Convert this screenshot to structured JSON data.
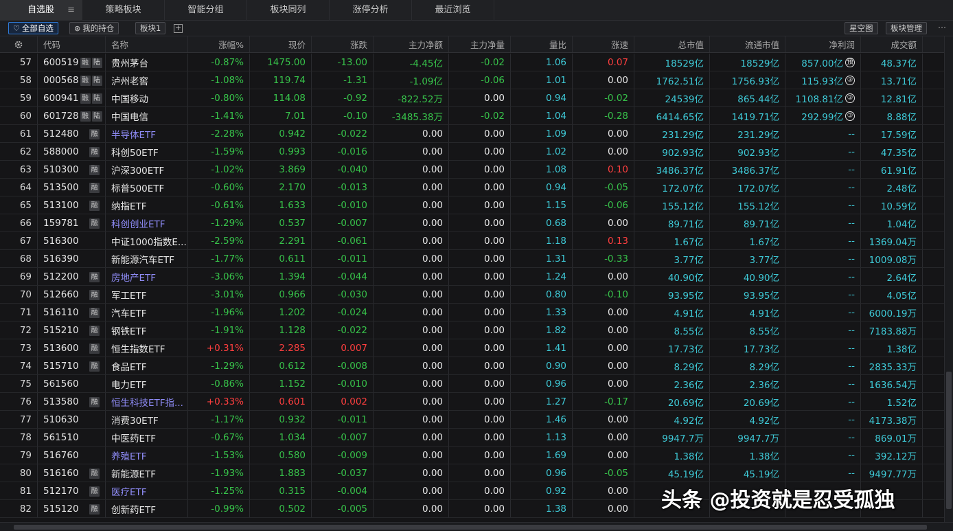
{
  "tabs": [
    {
      "label": "自选股",
      "active": true
    },
    {
      "label": "策略板块",
      "active": false
    },
    {
      "label": "智能分组",
      "active": false
    },
    {
      "label": "板块同列",
      "active": false
    },
    {
      "label": "涨停分析",
      "active": false
    },
    {
      "label": "最近浏览",
      "active": false
    }
  ],
  "toolbar": {
    "all_watchlist": "全部自选",
    "my_holdings": "我的持仓",
    "block1": "板块1",
    "add": "+",
    "star_chart": "星空图",
    "block_manage": "板块管理",
    "more": "⋯"
  },
  "columns": {
    "settings_icon": "gear-icon",
    "code": "代码",
    "name": "名称",
    "change_pct": "涨幅%",
    "price": "现价",
    "change": "涨跌",
    "main_net_amount": "主力净额",
    "main_net_ratio": "主力净量",
    "volume_ratio": "量比",
    "speed": "涨速",
    "total_mv": "总市值",
    "float_mv": "流通市值",
    "net_profit": "净利润",
    "turnover": "成交额"
  },
  "rows": [
    {
      "idx": "57",
      "code": "600519",
      "tags": [
        "融",
        "陆"
      ],
      "name": "贵州茅台",
      "link": false,
      "pct": "-0.87%",
      "price": "1475.00",
      "chg": "-13.00",
      "main_amt": "-4.45亿",
      "main_net": "-0.02",
      "vr": "1.06",
      "speed": "0.07",
      "total": "18529亿",
      "float": "18529亿",
      "profit": "857.00亿",
      "profit_badge": "预",
      "turnover": "48.37亿"
    },
    {
      "idx": "58",
      "code": "000568",
      "tags": [
        "融",
        "陆"
      ],
      "name": "泸州老窖",
      "link": false,
      "pct": "-1.08%",
      "price": "119.74",
      "chg": "-1.31",
      "main_amt": "-1.09亿",
      "main_net": "-0.06",
      "vr": "1.01",
      "speed": "0.00",
      "total": "1762.51亿",
      "float": "1756.93亿",
      "profit": "115.93亿",
      "profit_badge": "③",
      "turnover": "13.71亿"
    },
    {
      "idx": "59",
      "code": "600941",
      "tags": [
        "融",
        "陆"
      ],
      "name": "中国移动",
      "link": false,
      "pct": "-0.80%",
      "price": "114.08",
      "chg": "-0.92",
      "main_amt": "-822.52万",
      "main_net": "0.00",
      "vr": "0.94",
      "speed": "-0.02",
      "total": "24539亿",
      "float": "865.44亿",
      "profit": "1108.81亿",
      "profit_badge": "③",
      "turnover": "12.81亿"
    },
    {
      "idx": "60",
      "code": "601728",
      "tags": [
        "融",
        "陆"
      ],
      "name": "中国电信",
      "link": false,
      "pct": "-1.41%",
      "price": "7.01",
      "chg": "-0.10",
      "main_amt": "-3485.38万",
      "main_net": "-0.02",
      "vr": "1.04",
      "speed": "-0.28",
      "total": "6414.65亿",
      "float": "1419.71亿",
      "profit": "292.99亿",
      "profit_badge": "③",
      "turnover": "8.88亿"
    },
    {
      "idx": "61",
      "code": "512480",
      "tags": [
        "融"
      ],
      "name": "半导体ETF",
      "link": true,
      "pct": "-2.28%",
      "price": "0.942",
      "chg": "-0.022",
      "main_amt": "0.00",
      "main_net": "0.00",
      "vr": "1.09",
      "speed": "0.00",
      "total": "231.29亿",
      "float": "231.29亿",
      "profit": "--",
      "profit_badge": "",
      "turnover": "17.59亿"
    },
    {
      "idx": "62",
      "code": "588000",
      "tags": [
        "融"
      ],
      "name": "科创50ETF",
      "link": false,
      "pct": "-1.59%",
      "price": "0.993",
      "chg": "-0.016",
      "main_amt": "0.00",
      "main_net": "0.00",
      "vr": "1.02",
      "speed": "0.00",
      "total": "902.93亿",
      "float": "902.93亿",
      "profit": "--",
      "profit_badge": "",
      "turnover": "47.35亿"
    },
    {
      "idx": "63",
      "code": "510300",
      "tags": [
        "融"
      ],
      "name": "沪深300ETF",
      "link": false,
      "pct": "-1.02%",
      "price": "3.869",
      "chg": "-0.040",
      "main_amt": "0.00",
      "main_net": "0.00",
      "vr": "1.08",
      "speed": "0.10",
      "total": "3486.37亿",
      "float": "3486.37亿",
      "profit": "--",
      "profit_badge": "",
      "turnover": "61.91亿"
    },
    {
      "idx": "64",
      "code": "513500",
      "tags": [
        "融"
      ],
      "name": "标普500ETF",
      "link": false,
      "pct": "-0.60%",
      "price": "2.170",
      "chg": "-0.013",
      "main_amt": "0.00",
      "main_net": "0.00",
      "vr": "0.94",
      "speed": "-0.05",
      "total": "172.07亿",
      "float": "172.07亿",
      "profit": "--",
      "profit_badge": "",
      "turnover": "2.48亿"
    },
    {
      "idx": "65",
      "code": "513100",
      "tags": [
        "融"
      ],
      "name": "纳指ETF",
      "link": false,
      "pct": "-0.61%",
      "price": "1.633",
      "chg": "-0.010",
      "main_amt": "0.00",
      "main_net": "0.00",
      "vr": "1.15",
      "speed": "-0.06",
      "total": "155.12亿",
      "float": "155.12亿",
      "profit": "--",
      "profit_badge": "",
      "turnover": "10.59亿"
    },
    {
      "idx": "66",
      "code": "159781",
      "tags": [
        "融"
      ],
      "name": "科创创业ETF",
      "link": true,
      "pct": "-1.29%",
      "price": "0.537",
      "chg": "-0.007",
      "main_amt": "0.00",
      "main_net": "0.00",
      "vr": "0.68",
      "speed": "0.00",
      "total": "89.71亿",
      "float": "89.71亿",
      "profit": "--",
      "profit_badge": "",
      "turnover": "1.04亿"
    },
    {
      "idx": "67",
      "code": "516300",
      "tags": [],
      "name": "中证1000指数E...",
      "link": false,
      "pct": "-2.59%",
      "price": "2.291",
      "chg": "-0.061",
      "main_amt": "0.00",
      "main_net": "0.00",
      "vr": "1.18",
      "speed": "0.13",
      "total": "1.67亿",
      "float": "1.67亿",
      "profit": "--",
      "profit_badge": "",
      "turnover": "1369.04万"
    },
    {
      "idx": "68",
      "code": "516390",
      "tags": [],
      "name": "新能源汽车ETF",
      "link": false,
      "pct": "-1.77%",
      "price": "0.611",
      "chg": "-0.011",
      "main_amt": "0.00",
      "main_net": "0.00",
      "vr": "1.31",
      "speed": "-0.33",
      "total": "3.77亿",
      "float": "3.77亿",
      "profit": "--",
      "profit_badge": "",
      "turnover": "1009.08万"
    },
    {
      "idx": "69",
      "code": "512200",
      "tags": [
        "融"
      ],
      "name": "房地产ETF",
      "link": true,
      "pct": "-3.06%",
      "price": "1.394",
      "chg": "-0.044",
      "main_amt": "0.00",
      "main_net": "0.00",
      "vr": "1.24",
      "speed": "0.00",
      "total": "40.90亿",
      "float": "40.90亿",
      "profit": "--",
      "profit_badge": "",
      "turnover": "2.64亿"
    },
    {
      "idx": "70",
      "code": "512660",
      "tags": [
        "融"
      ],
      "name": "军工ETF",
      "link": false,
      "pct": "-3.01%",
      "price": "0.966",
      "chg": "-0.030",
      "main_amt": "0.00",
      "main_net": "0.00",
      "vr": "0.80",
      "speed": "-0.10",
      "total": "93.95亿",
      "float": "93.95亿",
      "profit": "--",
      "profit_badge": "",
      "turnover": "4.05亿"
    },
    {
      "idx": "71",
      "code": "516110",
      "tags": [
        "融"
      ],
      "name": "汽车ETF",
      "link": false,
      "pct": "-1.96%",
      "price": "1.202",
      "chg": "-0.024",
      "main_amt": "0.00",
      "main_net": "0.00",
      "vr": "1.33",
      "speed": "0.00",
      "total": "4.91亿",
      "float": "4.91亿",
      "profit": "--",
      "profit_badge": "",
      "turnover": "6000.19万"
    },
    {
      "idx": "72",
      "code": "515210",
      "tags": [
        "融"
      ],
      "name": "钢铁ETF",
      "link": false,
      "pct": "-1.91%",
      "price": "1.128",
      "chg": "-0.022",
      "main_amt": "0.00",
      "main_net": "0.00",
      "vr": "1.82",
      "speed": "0.00",
      "total": "8.55亿",
      "float": "8.55亿",
      "profit": "--",
      "profit_badge": "",
      "turnover": "7183.88万"
    },
    {
      "idx": "73",
      "code": "513600",
      "tags": [
        "融"
      ],
      "name": "恒生指数ETF",
      "link": false,
      "pct": "+0.31%",
      "price": "2.285",
      "chg": "0.007",
      "main_amt": "0.00",
      "main_net": "0.00",
      "vr": "1.41",
      "speed": "0.00",
      "total": "17.73亿",
      "float": "17.73亿",
      "profit": "--",
      "profit_badge": "",
      "turnover": "1.38亿"
    },
    {
      "idx": "74",
      "code": "515710",
      "tags": [
        "融"
      ],
      "name": "食品ETF",
      "link": false,
      "pct": "-1.29%",
      "price": "0.612",
      "chg": "-0.008",
      "main_amt": "0.00",
      "main_net": "0.00",
      "vr": "0.90",
      "speed": "0.00",
      "total": "8.29亿",
      "float": "8.29亿",
      "profit": "--",
      "profit_badge": "",
      "turnover": "2835.33万"
    },
    {
      "idx": "75",
      "code": "561560",
      "tags": [],
      "name": "电力ETF",
      "link": false,
      "pct": "-0.86%",
      "price": "1.152",
      "chg": "-0.010",
      "main_amt": "0.00",
      "main_net": "0.00",
      "vr": "0.96",
      "speed": "0.00",
      "total": "2.36亿",
      "float": "2.36亿",
      "profit": "--",
      "profit_badge": "",
      "turnover": "1636.54万"
    },
    {
      "idx": "76",
      "code": "513580",
      "tags": [
        "融"
      ],
      "name": "恒生科技ETF指...",
      "link": true,
      "pct": "+0.33%",
      "price": "0.601",
      "chg": "0.002",
      "main_amt": "0.00",
      "main_net": "0.00",
      "vr": "1.27",
      "speed": "-0.17",
      "total": "20.69亿",
      "float": "20.69亿",
      "profit": "--",
      "profit_badge": "",
      "turnover": "1.52亿"
    },
    {
      "idx": "77",
      "code": "510630",
      "tags": [],
      "name": "消费30ETF",
      "link": false,
      "pct": "-1.17%",
      "price": "0.932",
      "chg": "-0.011",
      "main_amt": "0.00",
      "main_net": "0.00",
      "vr": "1.46",
      "speed": "0.00",
      "total": "4.92亿",
      "float": "4.92亿",
      "profit": "--",
      "profit_badge": "",
      "turnover": "4173.38万"
    },
    {
      "idx": "78",
      "code": "561510",
      "tags": [],
      "name": "中医药ETF",
      "link": false,
      "pct": "-0.67%",
      "price": "1.034",
      "chg": "-0.007",
      "main_amt": "0.00",
      "main_net": "0.00",
      "vr": "1.13",
      "speed": "0.00",
      "total": "9947.7万",
      "float": "9947.7万",
      "profit": "--",
      "profit_badge": "",
      "turnover": "869.01万"
    },
    {
      "idx": "79",
      "code": "516760",
      "tags": [],
      "name": "养殖ETF",
      "link": true,
      "pct": "-1.53%",
      "price": "0.580",
      "chg": "-0.009",
      "main_amt": "0.00",
      "main_net": "0.00",
      "vr": "1.69",
      "speed": "0.00",
      "total": "1.38亿",
      "float": "1.38亿",
      "profit": "--",
      "profit_badge": "",
      "turnover": "392.12万"
    },
    {
      "idx": "80",
      "code": "516160",
      "tags": [
        "融"
      ],
      "name": "新能源ETF",
      "link": false,
      "pct": "-1.93%",
      "price": "1.883",
      "chg": "-0.037",
      "main_amt": "0.00",
      "main_net": "0.00",
      "vr": "0.96",
      "speed": "-0.05",
      "total": "45.19亿",
      "float": "45.19亿",
      "profit": "--",
      "profit_badge": "",
      "turnover": "9497.77万"
    },
    {
      "idx": "81",
      "code": "512170",
      "tags": [
        "融"
      ],
      "name": "医疗ETF",
      "link": true,
      "pct": "-1.25%",
      "price": "0.315",
      "chg": "-0.004",
      "main_amt": "0.00",
      "main_net": "0.00",
      "vr": "0.92",
      "speed": "0.00",
      "total": "",
      "float": "",
      "profit": "",
      "profit_badge": "",
      "turnover": ""
    },
    {
      "idx": "82",
      "code": "515120",
      "tags": [
        "融"
      ],
      "name": "创新药ETF",
      "link": false,
      "pct": "-0.99%",
      "price": "0.502",
      "chg": "-0.005",
      "main_amt": "0.00",
      "main_net": "0.00",
      "vr": "1.38",
      "speed": "0.00",
      "total": "",
      "float": "",
      "profit": "",
      "profit_badge": "",
      "turnover": ""
    }
  ],
  "watermark": "头条 @投资就是忍受孤独",
  "colors": {
    "up": "#ff3f3f",
    "down": "#37c24a",
    "cyan": "#3ec9d6",
    "link": "#8f8cf7"
  }
}
